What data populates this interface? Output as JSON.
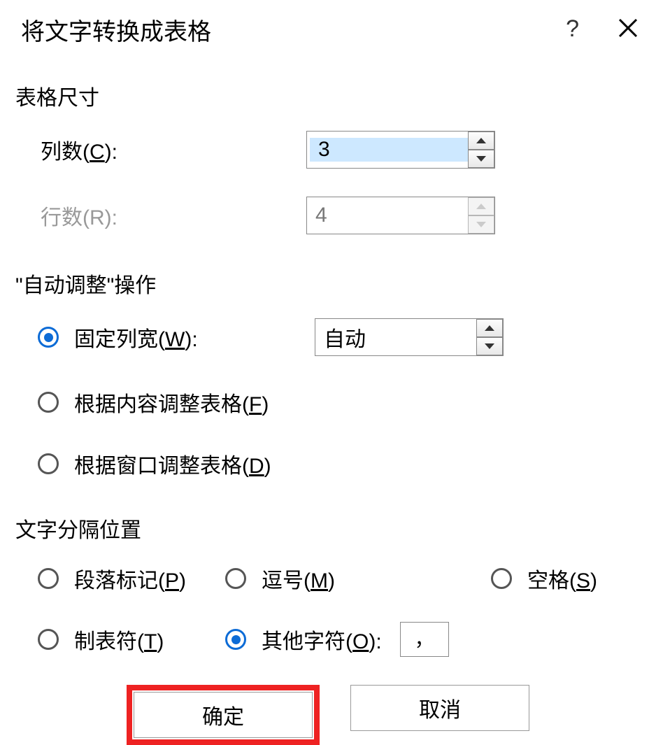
{
  "dialog": {
    "title": "将文字转换成表格",
    "help": "?",
    "close": "×"
  },
  "sections": {
    "size": "表格尺寸",
    "autofit": "\"自动调整\"操作",
    "separator": "文字分隔位置"
  },
  "labels": {
    "cols_prefix": "列数(",
    "cols_key": "C",
    "cols_suffix": "):",
    "rows_prefix": "行数(R):",
    "fixed_width_prefix": "固定列宽(",
    "fixed_width_key": "W",
    "fixed_width_suffix": "):",
    "autofit_content_prefix": "根据内容调整表格(",
    "autofit_content_key": "F",
    "autofit_content_suffix": ")",
    "autofit_window_prefix": "根据窗口调整表格(",
    "autofit_window_key": "D",
    "autofit_window_suffix": ")",
    "sep_para_prefix": "段落标记(",
    "sep_para_key": "P",
    "sep_para_suffix": ")",
    "sep_comma_prefix": "逗号(",
    "sep_comma_key": "M",
    "sep_comma_suffix": ")",
    "sep_space_prefix": "空格(",
    "sep_space_key": "S",
    "sep_space_suffix": ")",
    "sep_tab_prefix": "制表符(",
    "sep_tab_key": "T",
    "sep_tab_suffix": ")",
    "sep_other_prefix": "其他字符(",
    "sep_other_key": "O",
    "sep_other_suffix": "):"
  },
  "values": {
    "cols": "3",
    "rows": "4",
    "fixed_width": "自动",
    "other_char": "，"
  },
  "buttons": {
    "ok": "确定",
    "cancel": "取消"
  }
}
